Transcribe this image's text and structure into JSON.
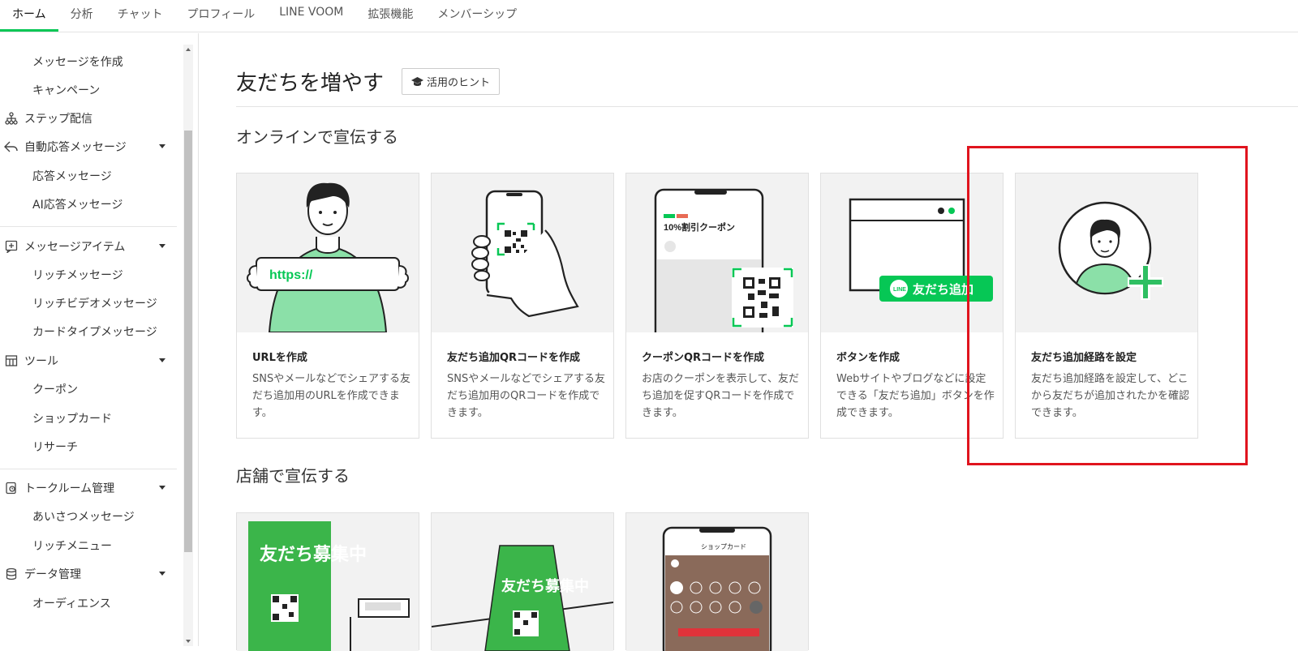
{
  "topnav": {
    "tabs": [
      "ホーム",
      "分析",
      "チャット",
      "プロフィール",
      "LINE VOOM",
      "拡張機能",
      "メンバーシップ"
    ]
  },
  "sidebar": {
    "items": [
      {
        "label": "メッセージを作成",
        "type": "sub"
      },
      {
        "label": "キャンペーン",
        "type": "sub"
      },
      {
        "label": "ステップ配信",
        "type": "head",
        "icon": "step-icon"
      },
      {
        "label": "自動応答メッセージ",
        "type": "head",
        "icon": "reply-icon",
        "caret": true
      },
      {
        "label": "応答メッセージ",
        "type": "sub"
      },
      {
        "label": "AI応答メッセージ",
        "type": "sub"
      },
      {
        "label": "メッセージアイテム",
        "type": "head",
        "icon": "message-item-icon",
        "caret": true
      },
      {
        "label": "リッチメッセージ",
        "type": "sub"
      },
      {
        "label": "リッチビデオメッセージ",
        "type": "sub"
      },
      {
        "label": "カードタイプメッセージ",
        "type": "sub"
      },
      {
        "label": "ツール",
        "type": "head",
        "icon": "tool-icon",
        "caret": true
      },
      {
        "label": "クーポン",
        "type": "sub"
      },
      {
        "label": "ショップカード",
        "type": "sub"
      },
      {
        "label": "リサーチ",
        "type": "sub"
      },
      {
        "label": "トークルーム管理",
        "type": "head",
        "icon": "talkroom-icon",
        "caret": true
      },
      {
        "label": "あいさつメッセージ",
        "type": "sub"
      },
      {
        "label": "リッチメニュー",
        "type": "sub"
      },
      {
        "label": "データ管理",
        "type": "head",
        "icon": "database-icon",
        "caret": true
      },
      {
        "label": "オーディエンス",
        "type": "sub"
      }
    ]
  },
  "main": {
    "title": "友だちを増やす",
    "hint_label": "活用のヒント",
    "online_section": "オンラインで宣伝する",
    "store_section": "店舗で宣伝する",
    "online_cards": [
      {
        "title": "URLを作成",
        "desc": "SNSやメールなどでシェアする友だち追加用のURLを作成できます。",
        "url_text": "https://"
      },
      {
        "title": "友だち追加QRコードを作成",
        "desc": "SNSやメールなどでシェアする友だち追加用のQRコードを作成できます。"
      },
      {
        "title": "クーポンQRコードを作成",
        "desc": "お店のクーポンを表示して、友だち追加を促すQRコードを作成できます。",
        "coupon_text": "10%割引クーポン"
      },
      {
        "title": "ボタンを作成",
        "desc": "Webサイトやブログなどに設定できる「友だち追加」ボタンを作成できます。",
        "button_text": "友だち追加",
        "line_text": "LINE"
      },
      {
        "title": "友だち追加経路を設定",
        "desc": "友だち追加経路を設定して、どこから友だちが追加されたかを確認できます。"
      }
    ],
    "store_cards": [
      {
        "poster_text": "友だち募集中"
      },
      {
        "poster_text": "友だち募集中"
      },
      {
        "phone_header": "ショップカード"
      }
    ]
  },
  "colors": {
    "accent": "#06c755",
    "highlight": "#e0141e"
  }
}
